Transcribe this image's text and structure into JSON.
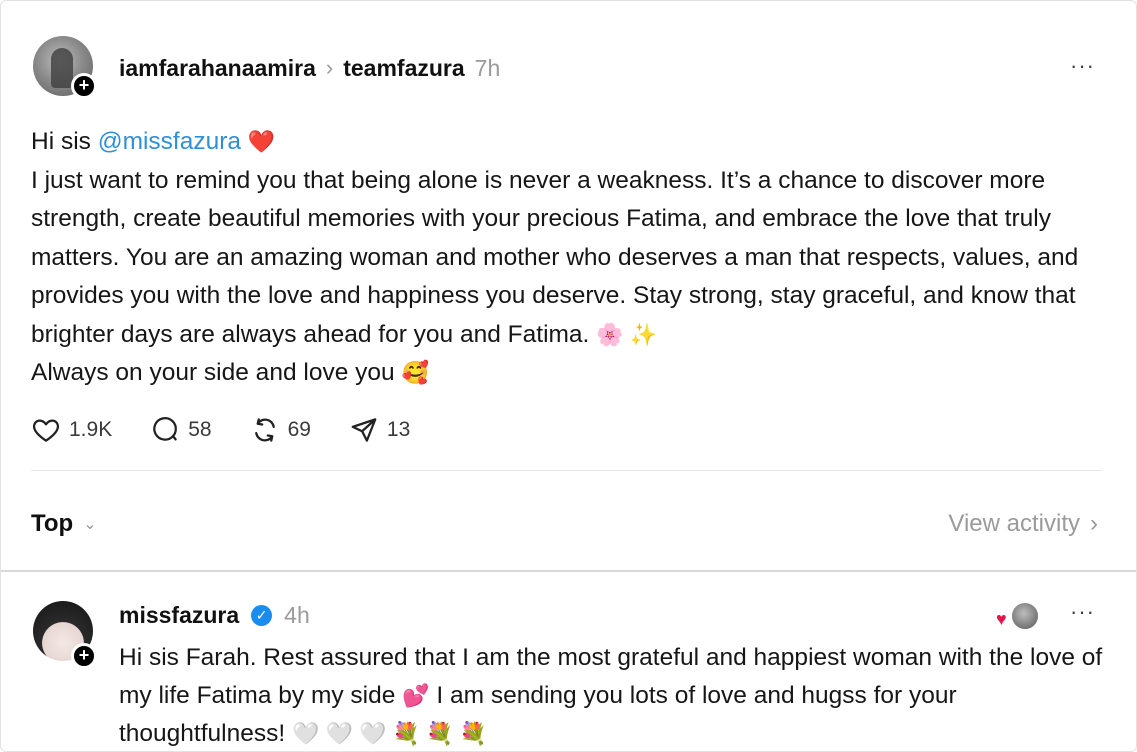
{
  "post": {
    "author": "iamfarahanaamira",
    "reply_to": "teamfazura",
    "time": "7h",
    "greeting_prefix": "Hi sis ",
    "mention": "@missfazura",
    "greeting_emoji": "❤️",
    "body_text": "I just want to remind you that being alone is never a weakness. It’s a chance to discover more strength, create beautiful memories with your precious Fatima, and embrace the love that truly matters. You are an amazing woman and mother who deserves a man that respects, values, and provides you with the love and happiness you deserve. Stay strong, stay graceful, and know that brighter days are always ahead for you and Fatima.",
    "body_emojis": "🌸 ✨",
    "closing": "Always on your side and love you",
    "closing_emoji": "🥰",
    "likes": "1.9K",
    "comments": "58",
    "reposts": "69",
    "shares": "13"
  },
  "sort": {
    "label": "Top",
    "view_activity": "View activity"
  },
  "reply": {
    "author": "missfazura",
    "time": "4h",
    "text_1": "Hi sis Farah. Rest assured that I am the most grateful and happiest woman with the love of my life Fatima by my side",
    "emoji_1": "💕",
    "text_2": "I am sending you lots of love and hugss for your thoughtfulness!",
    "emoji_2": "🤍 🤍 🤍 💐 💐 💐"
  },
  "colors": {
    "mention": "#2f8fd7",
    "muted": "#9a9a9a",
    "verified": "#1a8cf0",
    "heart": "#e5174a"
  },
  "icons": [
    "plus-icon",
    "chevron-right-icon",
    "more-icon",
    "heart-icon",
    "comment-icon",
    "repost-icon",
    "share-icon",
    "chevron-down-icon",
    "verified-icon"
  ]
}
